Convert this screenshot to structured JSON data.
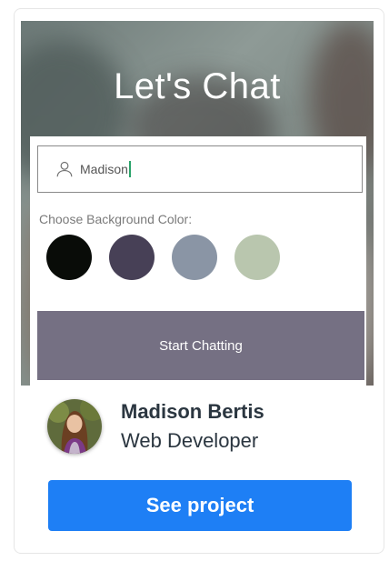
{
  "preview": {
    "app_title": "Let's Chat",
    "name_input_value": "Madison",
    "background_label": "Choose Background Color:",
    "swatch_colors": [
      "#090c08",
      "#474056",
      "#8a95a5",
      "#b9c6ae"
    ],
    "start_button_label": "Start Chatting",
    "input_icon": "user-icon"
  },
  "author": {
    "name": "Madison Bertis",
    "role": "Web Developer"
  },
  "cta": {
    "label": "See project",
    "color": "#1e7ff5"
  }
}
